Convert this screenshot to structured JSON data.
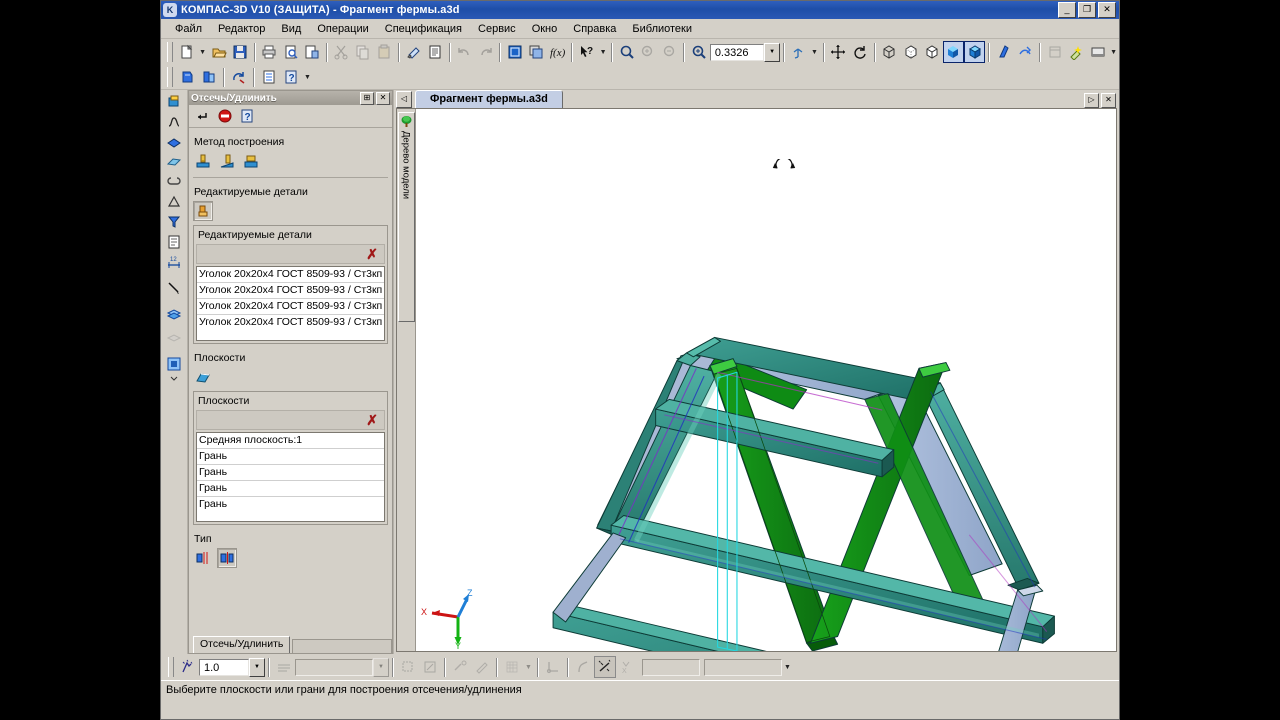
{
  "window": {
    "title": "КОМПАС-3D V10 (ЗАЩИТА) - Фрагмент фермы.a3d",
    "app_icon": "compas-icon",
    "buttons": {
      "minimize": "_",
      "restore": "❐",
      "close": "✕"
    }
  },
  "menu": {
    "items": [
      {
        "label": "Файл"
      },
      {
        "label": "Редактор"
      },
      {
        "label": "Вид"
      },
      {
        "label": "Операции"
      },
      {
        "label": "Спецификация"
      },
      {
        "label": "Сервис"
      },
      {
        "label": "Окно"
      },
      {
        "label": "Справка"
      },
      {
        "label": "Библиотеки"
      }
    ]
  },
  "toolbar": {
    "zoom_value": "0.3326",
    "items": [
      {
        "name": "new-document-icon"
      },
      {
        "name": "open-document-icon"
      },
      {
        "name": "save-icon"
      },
      {
        "name": "print-icon"
      },
      {
        "name": "print-preview-icon"
      },
      {
        "name": "page-setup-icon"
      },
      {
        "name": "cut-icon"
      },
      {
        "name": "copy-icon"
      },
      {
        "name": "paste-icon"
      },
      {
        "name": "format-painter-icon"
      },
      {
        "name": "properties-icon"
      },
      {
        "name": "undo-icon"
      },
      {
        "name": "redo-icon"
      },
      {
        "name": "manager-document-icon"
      },
      {
        "name": "specification-icon"
      },
      {
        "name": "variables-fx-icon"
      },
      {
        "name": "whats-this-help-icon"
      },
      {
        "name": "zoom-window-icon"
      },
      {
        "name": "zoom-in-icon"
      },
      {
        "name": "zoom-out-icon"
      },
      {
        "name": "zoom-scale-icon"
      },
      {
        "name": "orientation-icon"
      },
      {
        "name": "pan-icon"
      },
      {
        "name": "rotate-icon"
      },
      {
        "name": "wireframe-icon"
      },
      {
        "name": "hidden-lines-thin-icon"
      },
      {
        "name": "no-hidden-lines-icon"
      },
      {
        "name": "shaded-icon"
      },
      {
        "name": "shaded-with-edges-icon"
      },
      {
        "name": "perspective-icon"
      },
      {
        "name": "section-icon"
      },
      {
        "name": "simplify-icon"
      },
      {
        "name": "light-icon"
      },
      {
        "name": "display-settings-icon"
      }
    ],
    "row2": [
      {
        "name": "insert-part-icon"
      },
      {
        "name": "insert-assembly-icon"
      },
      {
        "name": "rebuild-icon"
      },
      {
        "name": "list-icon"
      },
      {
        "name": "help-query-icon"
      }
    ]
  },
  "compact_toolbar": {
    "items": [
      {
        "name": "edit-part-icon"
      },
      {
        "name": "spatial-curve-icon"
      },
      {
        "name": "surface-icon"
      },
      {
        "name": "plane-icon"
      },
      {
        "name": "mate-icon"
      },
      {
        "name": "measure-icon"
      },
      {
        "name": "filter-icon"
      },
      {
        "name": "spec-object-icon"
      },
      {
        "name": "dimension-icon"
      },
      {
        "name": "sketch-line-icon"
      },
      {
        "name": "array-icon"
      },
      {
        "name": "pattern-icon"
      },
      {
        "name": "library-icon"
      }
    ]
  },
  "property_panel": {
    "title": "Отсечь/Удлинить",
    "pin_label": "⊞",
    "close_label": "✕",
    "tool_icons": [
      {
        "name": "create-object-icon"
      },
      {
        "name": "interrupt-command-icon"
      },
      {
        "name": "help-icon"
      }
    ],
    "groups": {
      "method": {
        "label": "Метод построения",
        "options": [
          {
            "name": "method-trim-by-plane-icon",
            "selected": false
          },
          {
            "name": "method-trim-angle-icon",
            "selected": false
          },
          {
            "name": "method-extend-icon",
            "selected": false
          }
        ]
      },
      "parts": {
        "label": "Редактируемые детали",
        "pick_icon": {
          "name": "select-parts-icon",
          "selected": true
        },
        "list_title": "Редактируемые детали",
        "clear_label": "✗",
        "items": [
          "Уголок 20x20x4 ГОСТ 8509-93 / Ст3кп",
          "Уголок 20x20x4 ГОСТ 8509-93 / Ст3кп",
          "Уголок 20x20x4 ГОСТ 8509-93 / Ст3кп",
          "Уголок 20x20x4 ГОСТ 8509-93 / Ст3кп"
        ]
      },
      "planes": {
        "label": "Плоскости",
        "pick_icon": {
          "name": "select-plane-icon",
          "selected": false
        },
        "list_title": "Плоскости",
        "clear_label": "✗",
        "items": [
          "Средняя плоскость:1",
          "Грань",
          "Грань",
          "Грань",
          "Грань"
        ]
      },
      "type": {
        "label": "Тип",
        "options": [
          {
            "name": "type-one-side-icon",
            "selected": false
          },
          {
            "name": "type-both-sides-icon",
            "selected": true
          }
        ]
      }
    },
    "tab_label": "Отсечь/Удлинить"
  },
  "document": {
    "tab_label": "Фрагмент фермы.a3d",
    "scroll_left_label": "◁",
    "buttons": {
      "restore": "▷",
      "close": "✕"
    },
    "tree_tab_label": "Дерево модели",
    "tree_icon": "model-tree-icon",
    "rotate_marker": "rotate-cursor-marker",
    "axes": {
      "x": "X",
      "y": "Y",
      "z": "Z",
      "x_color": "#cc1414",
      "y_color": "#13b313",
      "z_color": "#1f7fd6"
    }
  },
  "bottom_toolbar": {
    "step_value": "1.0",
    "combo_value": "",
    "items": [
      {
        "name": "snap-point-icon"
      },
      {
        "name": "line-style-icon"
      },
      {
        "name": "layer-combo"
      },
      {
        "name": "group-icon"
      },
      {
        "name": "edit-group-icon"
      },
      {
        "name": "hatch-icon"
      },
      {
        "name": "highlight-icon"
      },
      {
        "name": "grid-icon"
      },
      {
        "name": "local-cs-icon"
      },
      {
        "name": "step-curve-icon"
      },
      {
        "name": "snap-settings-icon"
      },
      {
        "name": "restriction-icon"
      }
    ]
  },
  "status": {
    "text": "Выберите плоскости или грани для построения отсечения/удлинения"
  }
}
